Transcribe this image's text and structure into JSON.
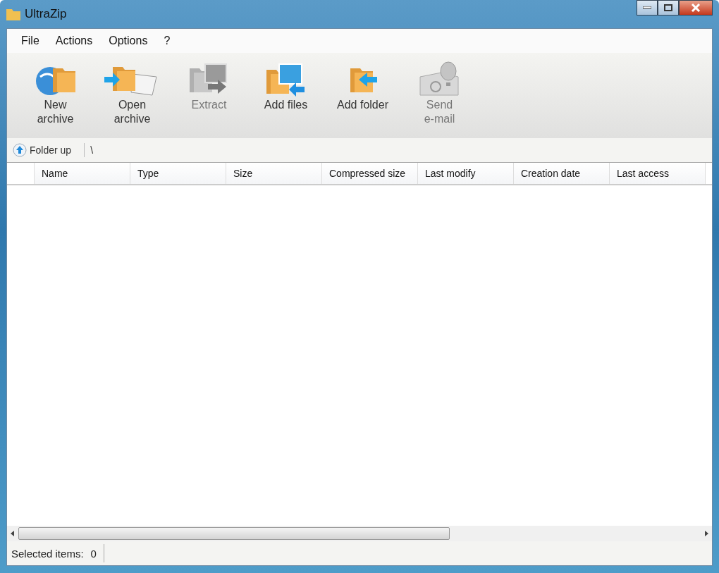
{
  "window": {
    "title": "UltraZip"
  },
  "menu": [
    "File",
    "Actions",
    "Options",
    "?"
  ],
  "toolbar": [
    {
      "kind": "new",
      "label": "New\narchive",
      "disabled": false
    },
    {
      "kind": "open",
      "label": "Open\narchive",
      "disabled": false
    },
    {
      "kind": "extract",
      "label": "Extract",
      "disabled": true
    },
    {
      "kind": "addfiles",
      "label": "Add files",
      "disabled": false
    },
    {
      "kind": "addfolder",
      "label": "Add folder",
      "disabled": false
    },
    {
      "kind": "mail",
      "label": "Send\ne-mail",
      "disabled": true
    }
  ],
  "pathbar": {
    "folder_up": "Folder up",
    "path": "\\"
  },
  "table": {
    "columns": [
      "Name",
      "Type",
      "Size",
      "Compressed size",
      "Last modify",
      "Creation date",
      "Last access"
    ]
  },
  "status_bar": {
    "label": "Selected items:",
    "count": "0"
  }
}
